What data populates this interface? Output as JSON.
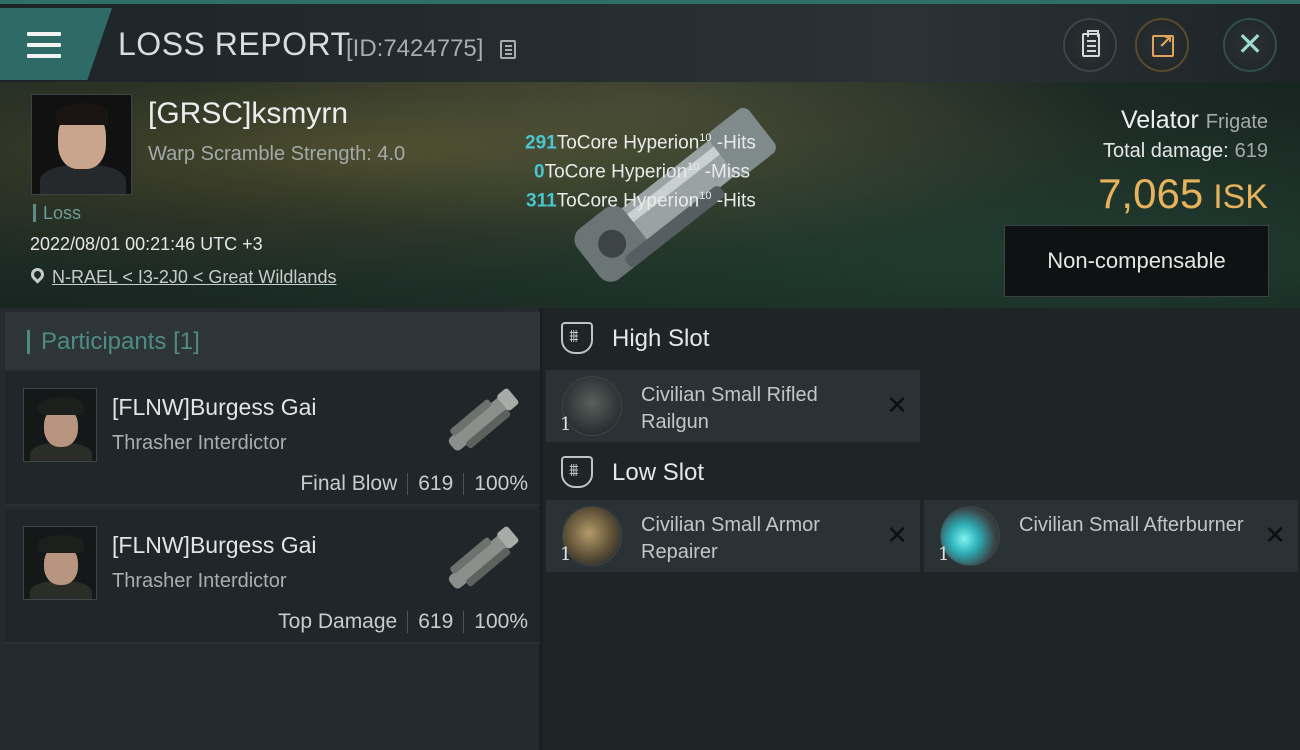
{
  "header": {
    "title": "LOSS REPORT",
    "report_id": "[ID:7424775]",
    "icons": [
      "menu-icon",
      "copy-icon",
      "clipboard-icon",
      "share-icon",
      "close-icon"
    ]
  },
  "victim": {
    "name": "[GRSC]ksmyrn",
    "warp_scramble": "Warp Scramble Strength: 4.0",
    "status": "Loss",
    "datetime": "2022/08/01 00:21:46 UTC +3",
    "location": "N-RAEL < I3-2J0 < Great Wildlands",
    "ship_name": "Velator",
    "ship_class": "Frigate",
    "total_damage_label": "Total damage:",
    "total_damage_value": "619",
    "isk_value": "7,065",
    "isk_unit": "ISK",
    "compensation": "Non-compensable"
  },
  "hits": [
    {
      "num": "291",
      "target": "ToCore Hyperion",
      "level": "10",
      "result": " -Hits"
    },
    {
      "num": "0",
      "target": "ToCore Hyperion",
      "level": "10",
      "result": " -Miss"
    },
    {
      "num": "311",
      "target": "ToCore Hyperion",
      "level": "10",
      "result": " -Hits"
    }
  ],
  "participants": {
    "label": "Participants",
    "count": "[1]",
    "items": [
      {
        "name": "[FLNW]Burgess Gai",
        "ship": "Thrasher Interdictor",
        "role": "Final Blow",
        "damage": "619",
        "percent": "100%"
      },
      {
        "name": "[FLNW]Burgess Gai",
        "ship": "Thrasher Interdictor",
        "role": "Top Damage",
        "damage": "619",
        "percent": "100%"
      }
    ]
  },
  "slots": {
    "high": {
      "label": "High Slot",
      "modules": [
        {
          "name": "Civilian Small Rifled Railgun",
          "qty": "1",
          "icon": "railgun-icon"
        }
      ]
    },
    "low": {
      "label": "Low Slot",
      "modules": [
        {
          "name": "Civilian Small Armor Repairer",
          "qty": "1",
          "icon": "armor-repairer-icon"
        },
        {
          "name": "Civilian Small Afterburner",
          "qty": "1",
          "icon": "afterburner-icon"
        }
      ]
    }
  },
  "colors": {
    "accent": "#2f6b66",
    "isk": "#e6b25c",
    "hit_number": "#49c6d1",
    "participants_label": "#4f8b83"
  }
}
